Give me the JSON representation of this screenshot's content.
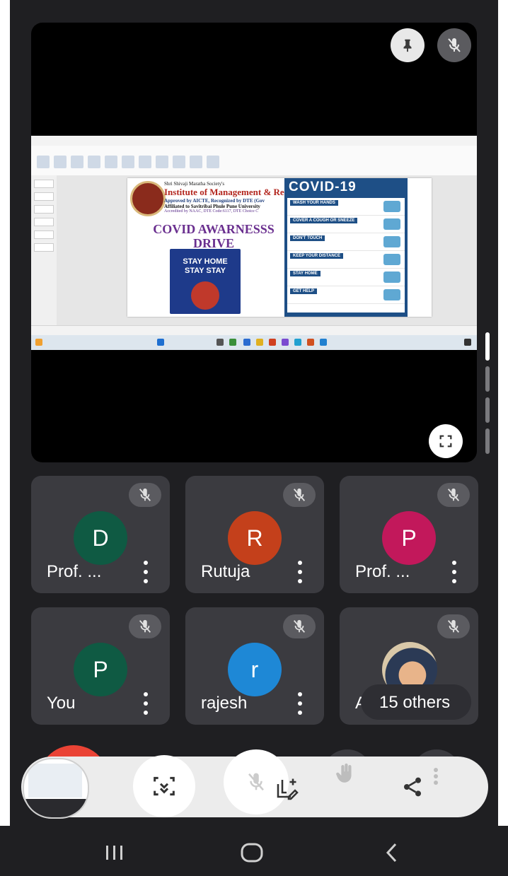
{
  "stage": {
    "pin_label": "pin-icon",
    "mute_label": "mic-off-icon",
    "fullscreen_label": "fullscreen-icon",
    "shared_screen": {
      "slide": {
        "org_line": "Shri Shivaji Maratha Society's",
        "institute": "Institute of Management & Rese",
        "approved": "Approved by AICTE, Recognized by DTE (Gov",
        "affiliated": "Affiliated to Savitribai Phule Pune University",
        "accredited": "Accredited by NAAC, DTE Code:6117, DTE Choice C",
        "heading_line1": "COVID AWARNESSS",
        "heading_line2": "DRIVE",
        "poster_line1": "STAY HOME",
        "poster_line2": "STAY STAY",
        "covid_title": "COVID-19",
        "covid_items": [
          "WASH YOUR HANDS",
          "COVER A COUGH OR SNEEZE",
          "DON'T TOUCH",
          "KEEP YOUR DISTANCE",
          "STAY HOME",
          "GET HELP"
        ]
      }
    }
  },
  "participants": [
    {
      "name": "Prof. ...",
      "initial": "D",
      "color": "#0f5a43"
    },
    {
      "name": "Rutuja",
      "initial": "R",
      "color": "#c4401b"
    },
    {
      "name": "Prof. ...",
      "initial": "P",
      "color": "#c2185b"
    },
    {
      "name": "You",
      "initial": "P",
      "color": "#0f5a43"
    },
    {
      "name": "rajesh",
      "initial": "r",
      "color": "#1e88d6"
    },
    {
      "name": "Ad",
      "initial": "",
      "color": "#3b3b40"
    }
  ],
  "others": {
    "label": "15 others"
  },
  "toolbar": {
    "buttons": [
      "camera-switch-icon",
      "mic-off-icon",
      "annotate-icon",
      "raise-hand-icon",
      "share-icon"
    ]
  },
  "navbar": {
    "items": [
      "recent-apps-icon",
      "home-icon",
      "back-icon"
    ]
  },
  "colors": {
    "background": "#1f1f22",
    "tile": "#3b3b40",
    "accent_red": "#ea4335"
  }
}
